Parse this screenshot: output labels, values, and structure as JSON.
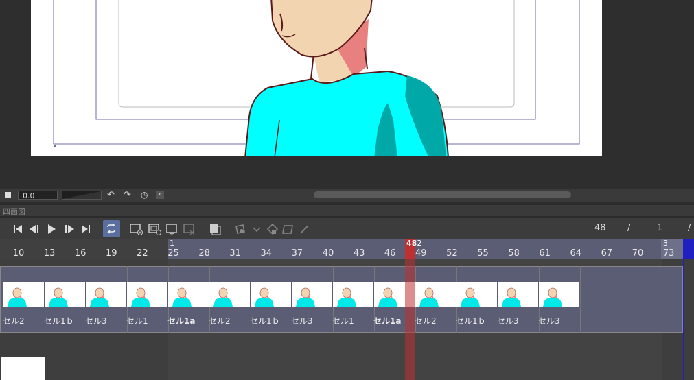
{
  "bottom_bar": {
    "zoom_value": "0.0"
  },
  "panel": {
    "title": "四面図"
  },
  "toolbar": {
    "current_frame": "48",
    "separator": "/",
    "page_number": "1",
    "separator2": "/"
  },
  "ruler": {
    "playhead_label": "48",
    "playhead_suffix": "2",
    "section_start": "1",
    "section_end": "3",
    "tick_labels": [
      "10",
      "13",
      "16",
      "19",
      "22",
      "25",
      "28",
      "31",
      "34",
      "37",
      "40",
      "43",
      "46",
      "49",
      "52",
      "55",
      "58",
      "61",
      "64",
      "67",
      "70",
      "73"
    ]
  },
  "track": {
    "cells": [
      "セル2",
      "セル1ｂ",
      "セル3",
      "セル1",
      "セル1a",
      "セル2",
      "セル1ｂ",
      "セル3",
      "セル1",
      "セル1a",
      "セル2",
      "セル1ｂ",
      "セル3",
      "セル3"
    ],
    "bold_cells": [
      4,
      9
    ]
  },
  "colors": {
    "accent": "#5a5d74",
    "playhead": "#c03030",
    "skin": "#f2d4b0",
    "shirt": "#00ffff",
    "shirt_shadow": "#00a8a8",
    "neck_shadow": "#e88080",
    "loop_button": "#5b6f9e"
  },
  "icons": [
    "stop-icon",
    "undo-icon",
    "redo-icon",
    "rotate-icon",
    "chevron-left-icon",
    "first-frame-icon",
    "prev-frame-icon",
    "play-icon",
    "next-frame-icon",
    "last-frame-icon",
    "loop-icon",
    "new-cel-icon",
    "new-folder-icon",
    "specify-cel-icon",
    "delete-cel-icon",
    "onion-skin-icon",
    "light-table-icon",
    "timeline-settings-icon",
    "edit-icon"
  ]
}
